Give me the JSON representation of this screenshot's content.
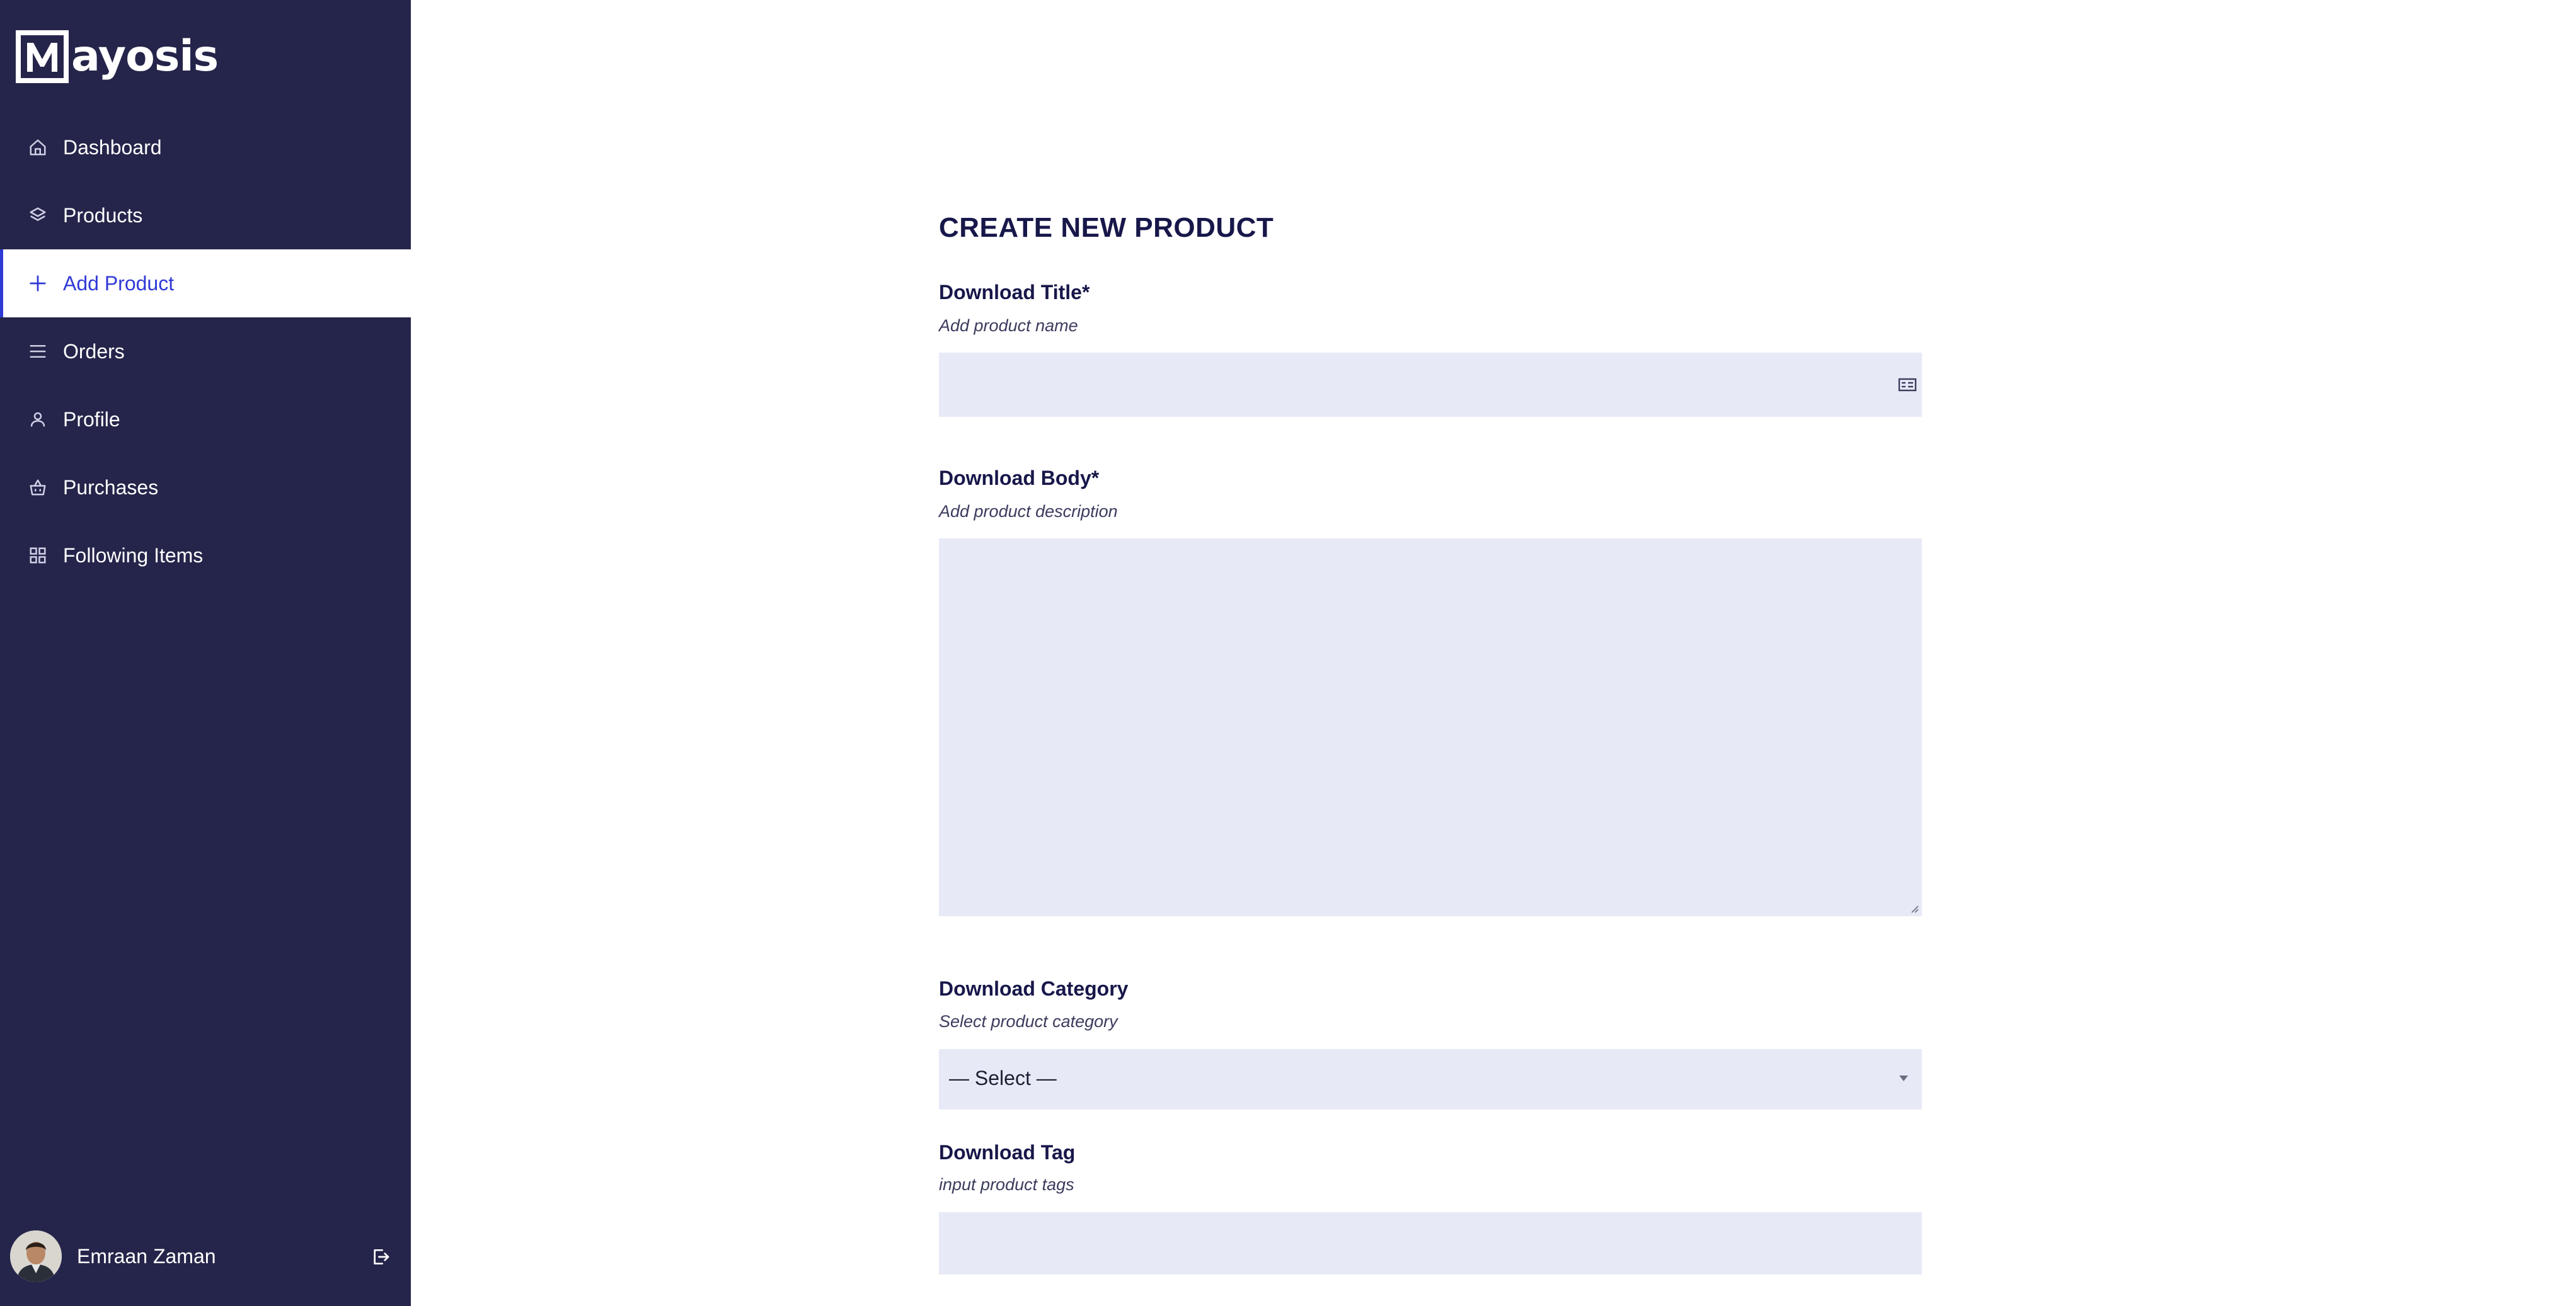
{
  "brand": {
    "logo_letter": "M",
    "logo_text": "ayosis"
  },
  "sidebar": {
    "items": [
      {
        "label": "Dashboard",
        "icon": "home-icon"
      },
      {
        "label": "Products",
        "icon": "layers-icon"
      },
      {
        "label": "Add Product",
        "icon": "plus-icon",
        "active": true
      },
      {
        "label": "Orders",
        "icon": "list-icon"
      },
      {
        "label": "Profile",
        "icon": "user-icon"
      },
      {
        "label": "Purchases",
        "icon": "basket-icon"
      },
      {
        "label": "Following Items",
        "icon": "grid-icon"
      }
    ],
    "user": {
      "name": "Emraan Zaman",
      "logout_icon": "logout-icon"
    }
  },
  "form": {
    "title": "CREATE NEW PRODUCT",
    "download_title": {
      "label": "Download Title*",
      "hint": "Add product name",
      "value": "",
      "icon": "id-card-icon"
    },
    "download_body": {
      "label": "Download Body*",
      "hint": "Add product description",
      "value": ""
    },
    "download_category": {
      "label": "Download Category",
      "hint": "Select product category",
      "selected": "— Select —"
    },
    "download_tag": {
      "label": "Download Tag",
      "hint": "input product tags",
      "value": ""
    }
  },
  "colors": {
    "sidebar_bg": "#25254b",
    "accent": "#2f3ad6",
    "field_bg": "#e7eaf6",
    "heading": "#17174a"
  }
}
